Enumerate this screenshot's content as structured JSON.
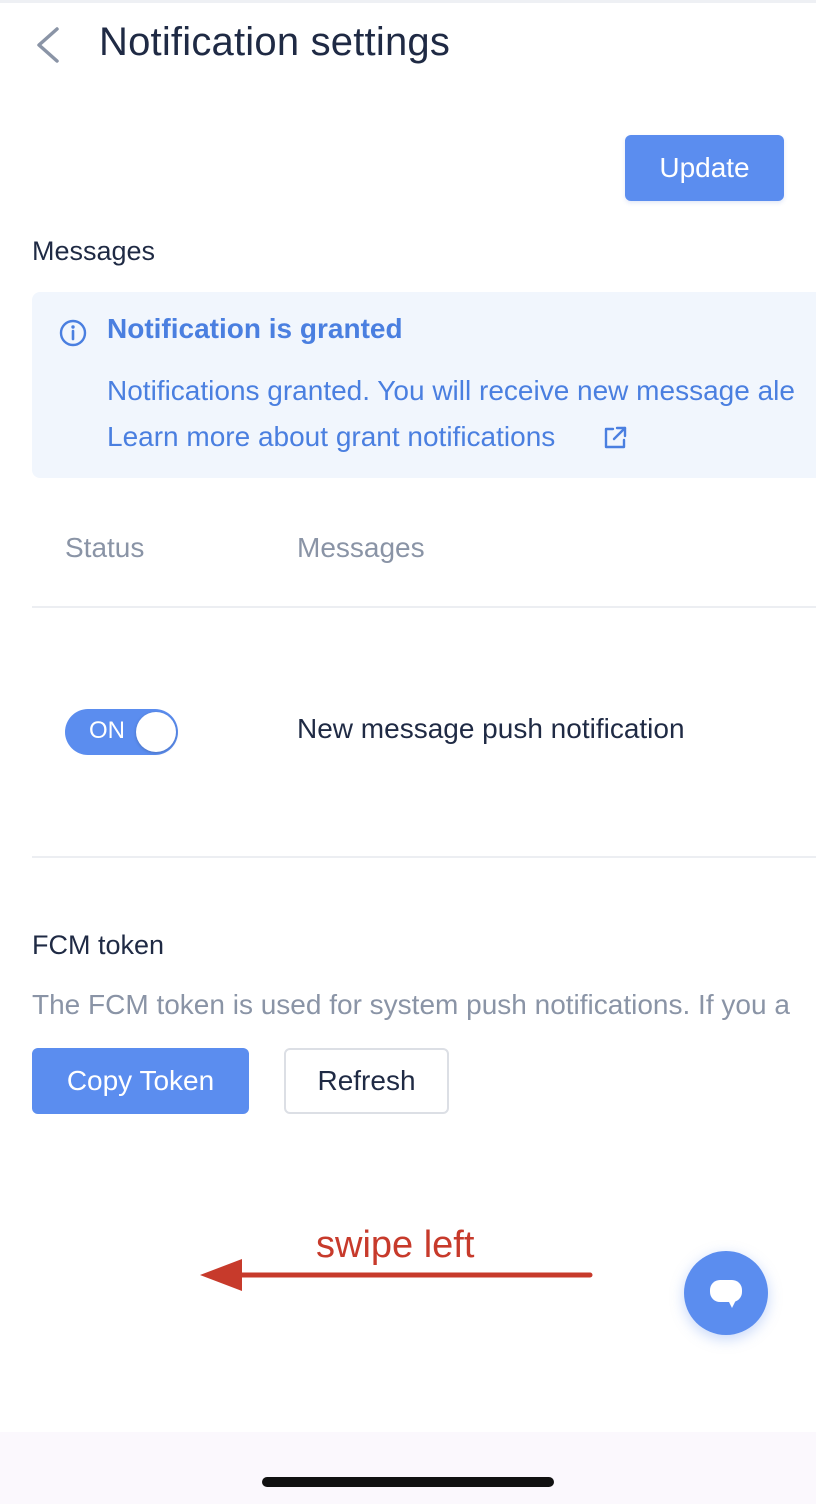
{
  "header": {
    "title": "Notification settings"
  },
  "toolbar": {
    "update_label": "Update"
  },
  "messages_section": {
    "title": "Messages",
    "info": {
      "title": "Notification is granted",
      "body": "Notifications granted. You will receive new message ale",
      "link": "Learn more about grant notifications"
    },
    "table": {
      "columns": [
        "Status",
        "Messages"
      ],
      "rows": [
        {
          "status_label": "ON",
          "status_on": true,
          "message": "New message push notification"
        }
      ]
    }
  },
  "fcm_section": {
    "title": "FCM token",
    "description": "The FCM token is used for system push notifications. If you a",
    "copy_label": "Copy Token",
    "refresh_label": "Refresh"
  },
  "annotation": {
    "text": "swipe left",
    "color": "#c73a2b"
  },
  "colors": {
    "accent": "#5b8def",
    "info_text": "#4a7fe0",
    "info_bg": "#f1f6fd"
  },
  "icons": [
    "chevron-left-icon",
    "info-icon",
    "external-link-icon",
    "chat-icon",
    "left-arrow-icon"
  ]
}
